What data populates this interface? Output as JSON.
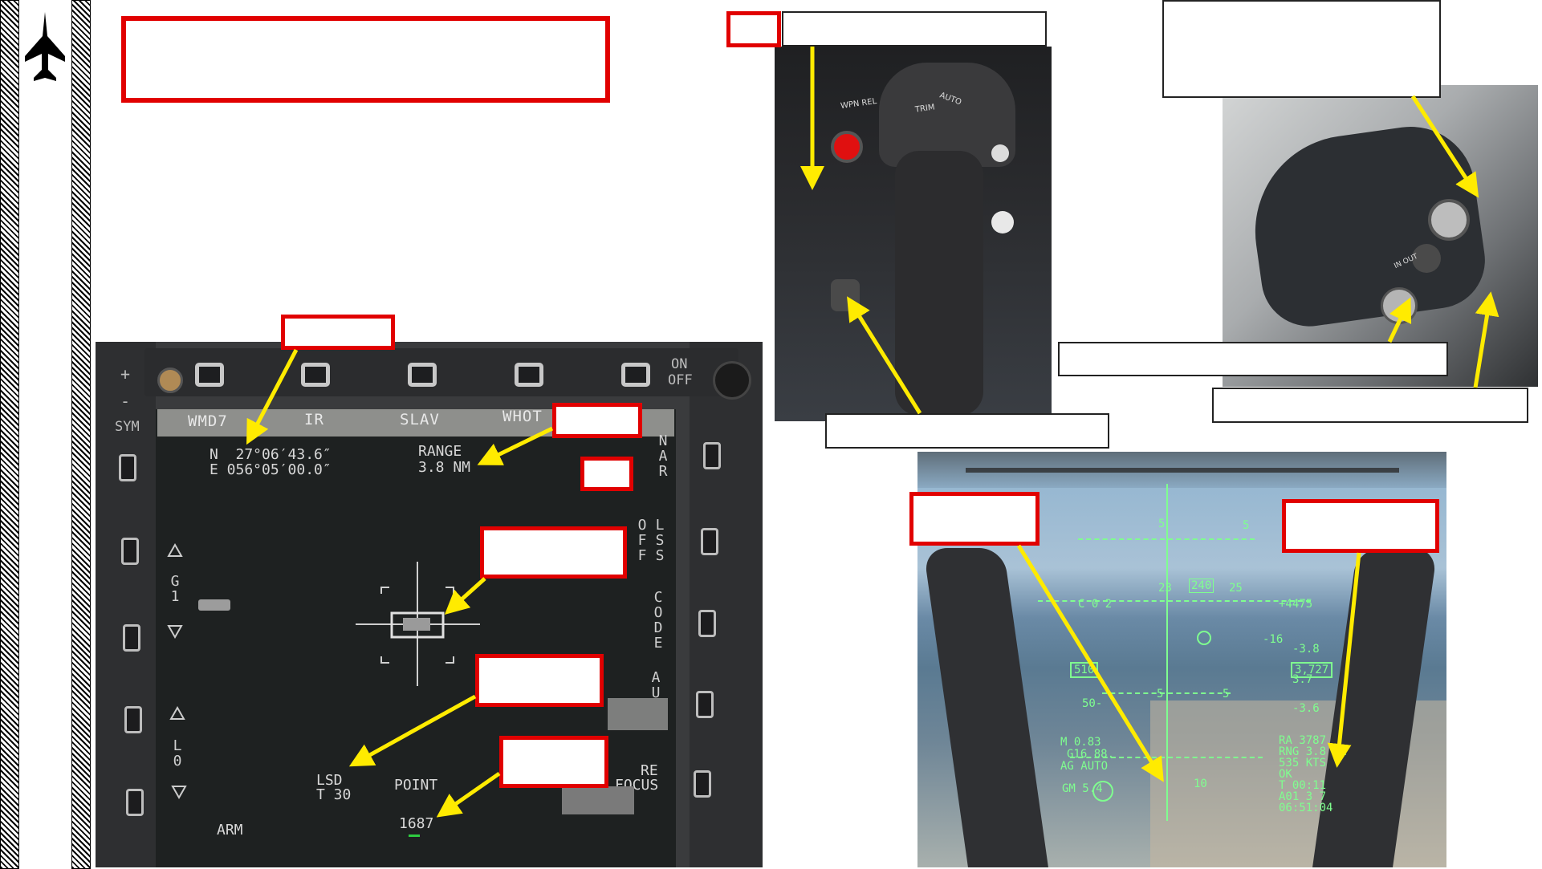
{
  "mfd": {
    "menu": [
      "WMD7",
      "IR",
      "SLAV",
      "WHOT"
    ],
    "on_off": [
      "ON",
      "OFF"
    ],
    "left_labels": {
      "sym": "SYM",
      "plus": "+",
      "minus": "-",
      "g1": "G\n1",
      "l0": "L\n0"
    },
    "right_vertical": {
      "nar": "NAR",
      "off": "OFF",
      "lss": "LSS",
      "code": "CODE",
      "auto": "AUTO",
      "re": "RE",
      "focus": "FOCUS"
    },
    "coords": {
      "lat": "N  27°06′43.6″",
      "lon": "E 056°05′00.0″"
    },
    "range": {
      "label": "RANGE",
      "value": "3.8 NM"
    },
    "lsd": "LSD",
    "t30": "T 30",
    "point": "POINT",
    "elevation": "1687",
    "arm": "ARM"
  },
  "stick": {
    "labels": [
      "WPN REL",
      "AUTO",
      "TRIM"
    ]
  },
  "throttle": {
    "labels": [
      "IN OUT"
    ]
  },
  "hud": {
    "ticks_top": [
      "5",
      "5"
    ],
    "heading": [
      "23",
      "240",
      "25"
    ],
    "alt_diff": "+4475",
    "airspeed": "510",
    "altitude": "3,727",
    "ladder_right": [
      "-16",
      "-3.8",
      "3.7",
      "-3.6"
    ],
    "ladder_left": [
      "C 0 2",
      "50-",
      "5",
      "5"
    ],
    "left_block": [
      "M 0.83",
      "G16  88.",
      "AG  AUTO",
      "GM 5.4"
    ],
    "right_block": [
      "RA 3787",
      "RNG 3.8 NM",
      "535 KTS",
      "OK",
      "T 00:11",
      "A01 3 7",
      "06:51:04"
    ],
    "bottom_mark": "10"
  },
  "colors": {
    "callout_red": "#e10000",
    "arrow_yellow": "#ffeb00",
    "hud_green": "#7fff8f"
  },
  "icons": {
    "logo": "jet-silhouette-icon"
  }
}
